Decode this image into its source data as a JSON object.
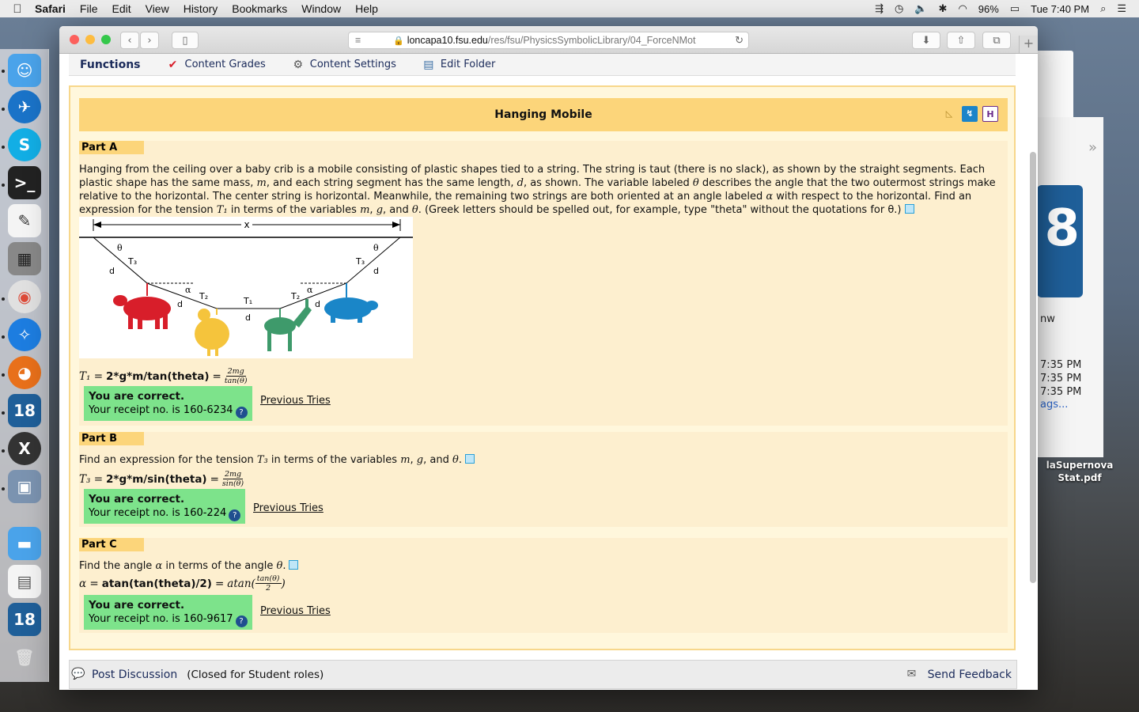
{
  "menubar": {
    "apple": "",
    "items": [
      "Safari",
      "File",
      "Edit",
      "View",
      "History",
      "Bookmarks",
      "Window",
      "Help"
    ],
    "battery": "96%",
    "clock": "Tue 7:40 PM"
  },
  "browser": {
    "url_host": "loncapa10.fsu.edu",
    "url_path": "/res/fsu/PhysicsSymbolicLibrary/04_ForceNMot"
  },
  "functions": {
    "title": "Functions",
    "content_grades": "Content Grades",
    "content_settings": "Content Settings",
    "edit_folder": "Edit Folder"
  },
  "problem": {
    "title": "Hanging Mobile",
    "part_a": {
      "label": "Part A",
      "text_line1": "Hanging from the ceiling over a baby crib is a mobile consisting of plastic shapes tied to a string. The string is taut (there is no slack), as shown by the straight segments. Each",
      "text_line2_a": "plastic shape has the same mass,",
      "text_line2_b": ", and each string segment has the same length,",
      "text_line2_c": ", as shown. The variable labeled",
      "text_line2_d": "describes the angle that the two outermost strings make",
      "text_line3_a": "relative to the horizontal. The center string is horizontal. Meanwhile, the remaining two strings are both oriented at an angle labeled",
      "text_line3_b": "with respect to the horizontal. Find an",
      "text_line4_a": "expression for the tension",
      "text_line4_b": "in terms of the variables",
      "text_line4_c": ", and",
      "text_line4_d": ". (Greek letters should be spelled out, for example, type \"theta\" without the quotations for θ.)",
      "answer_symbol": "T₁ =",
      "answer_text": "2*g*m/tan(theta)",
      "answer_eq": "=",
      "frac_num": "2mg",
      "frac_den": "tan(θ)",
      "correct": "You are correct.",
      "receipt": "Your receipt no. is 160-6234",
      "previous": "Previous Tries"
    },
    "part_b": {
      "label": "Part B",
      "text_a": "Find an expression for the tension",
      "text_b": "in terms of the variables",
      "text_c": ", and",
      "answer_symbol": "T₃ =",
      "answer_text": "2*g*m/sin(theta)",
      "answer_eq": "=",
      "frac_num": "2mg",
      "frac_den": "sin(θ)",
      "correct": "You are correct.",
      "receipt": "Your receipt no. is 160-224",
      "previous": "Previous Tries"
    },
    "part_c": {
      "label": "Part C",
      "text_a": "Find the angle",
      "text_b": "in terms of the angle",
      "answer_symbol": "α =",
      "answer_text": "atan(tan(theta)/2)",
      "answer_eq": "=",
      "answer_func": "atan(",
      "frac_num": "tan(θ)",
      "frac_den": "2",
      "answer_close": ")",
      "correct": "You are correct.",
      "receipt": "Your receipt no. is 160-9617",
      "previous": "Previous Tries"
    },
    "vars": {
      "m": "m",
      "d": "d",
      "theta": "θ",
      "alpha": "α",
      "g": "g",
      "T1": "T₁",
      "T3": "T₃"
    },
    "figure": {
      "x": "x",
      "theta": "θ",
      "alpha": "α",
      "d": "d",
      "T1": "T₁",
      "T2": "T₂",
      "T3": "T₃"
    }
  },
  "footer": {
    "post_discussion": "Post Discussion",
    "closed": "(Closed for Student roles)",
    "send_feedback": "Send Feedback"
  },
  "desktop": {
    "times": [
      "7:35 PM",
      "7:35 PM",
      "7:35 PM"
    ],
    "tags": "ags...",
    "nw": "nw",
    "file_label_1": "laSupernova",
    "file_label_2": "Stat.pdf"
  },
  "colors": {
    "title_bar": "#fcd57a",
    "problem_bg": "#fff7dc",
    "correct_bg": "#7de38b",
    "cow": "#d81e2a",
    "chicken": "#f5c43c",
    "donkey": "#3e9a6b",
    "pig": "#1a86c8"
  }
}
